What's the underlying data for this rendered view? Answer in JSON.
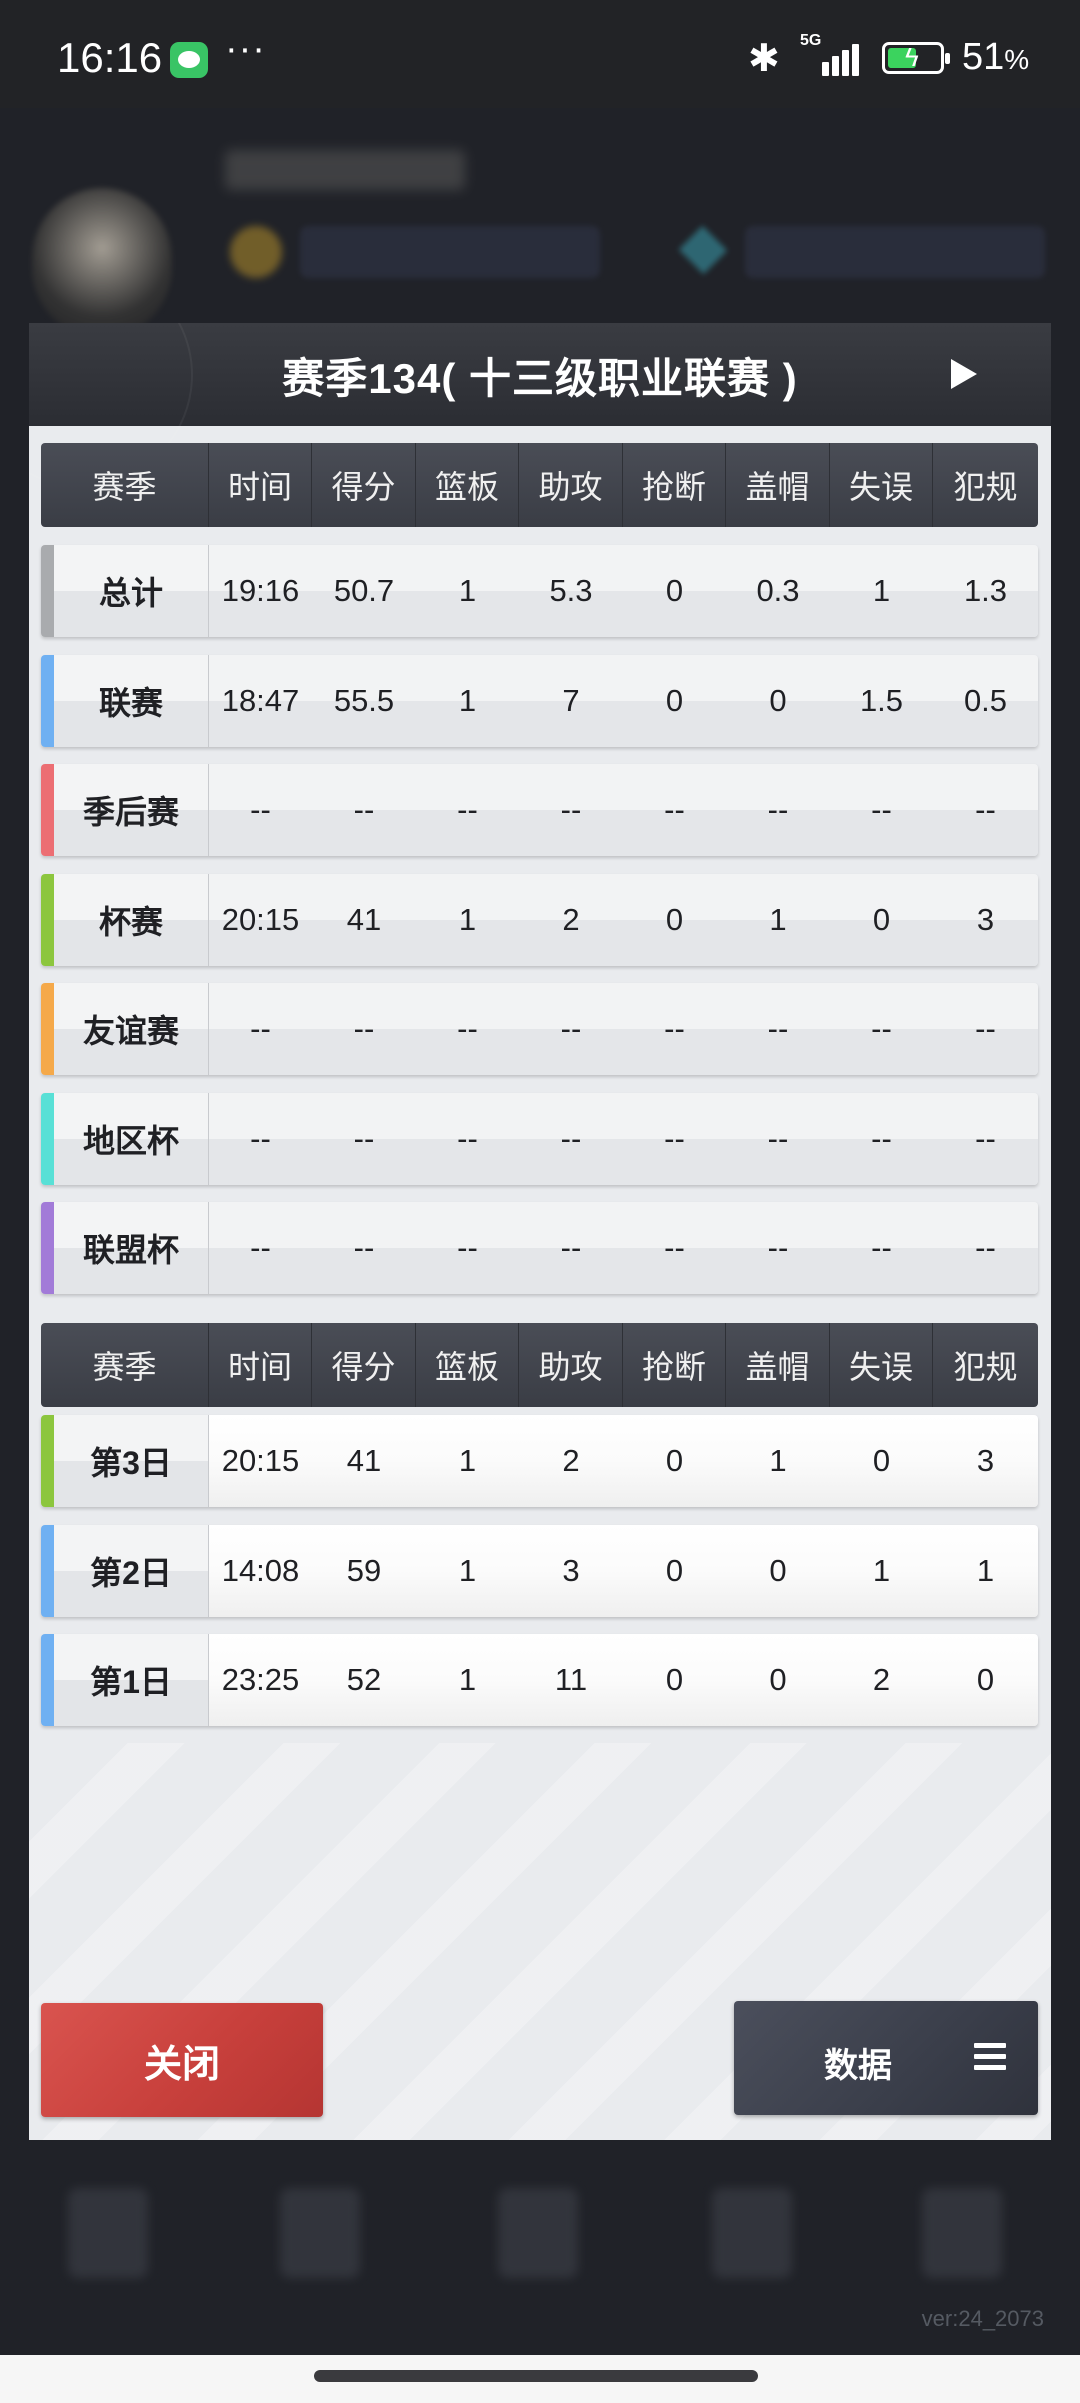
{
  "status_bar": {
    "time": "16:16",
    "battery": "51",
    "battery_unit": "%",
    "network": "5G",
    "more": "···"
  },
  "dialog": {
    "title": "赛季134( 十三级职业联赛 )",
    "columns": [
      "赛季",
      "时间",
      "得分",
      "篮板",
      "助攻",
      "抢断",
      "盖帽",
      "失误",
      "犯规"
    ],
    "season_rows": [
      {
        "label": "总计",
        "color": "#a9abae",
        "values": [
          "19:16",
          "50.7",
          "1",
          "5.3",
          "0",
          "0.3",
          "1",
          "1.3"
        ]
      },
      {
        "label": "联赛",
        "color": "#6fb0f2",
        "values": [
          "18:47",
          "55.5",
          "1",
          "7",
          "0",
          "0",
          "1.5",
          "0.5"
        ]
      },
      {
        "label": "季后赛",
        "color": "#ec6e73",
        "values": [
          "--",
          "--",
          "--",
          "--",
          "--",
          "--",
          "--",
          "--"
        ]
      },
      {
        "label": "杯赛",
        "color": "#8cc63e",
        "values": [
          "20:15",
          "41",
          "1",
          "2",
          "0",
          "1",
          "0",
          "3"
        ]
      },
      {
        "label": "友谊赛",
        "color": "#f5a94a",
        "values": [
          "--",
          "--",
          "--",
          "--",
          "--",
          "--",
          "--",
          "--"
        ]
      },
      {
        "label": "地区杯",
        "color": "#58e0d6",
        "values": [
          "--",
          "--",
          "--",
          "--",
          "--",
          "--",
          "--",
          "--"
        ]
      },
      {
        "label": "联盟杯",
        "color": "#a27bd8",
        "values": [
          "--",
          "--",
          "--",
          "--",
          "--",
          "--",
          "--",
          "--"
        ]
      }
    ],
    "day_rows": [
      {
        "label": "第3日",
        "color": "#8cc63e",
        "values": [
          "20:15",
          "41",
          "1",
          "2",
          "0",
          "1",
          "0",
          "3"
        ]
      },
      {
        "label": "第2日",
        "color": "#6fb0f2",
        "values": [
          "14:08",
          "59",
          "1",
          "3",
          "0",
          "0",
          "1",
          "1"
        ]
      },
      {
        "label": "第1日",
        "color": "#6fb0f2",
        "values": [
          "23:25",
          "52",
          "1",
          "11",
          "0",
          "0",
          "2",
          "0"
        ]
      }
    ],
    "close_label": "关闭",
    "data_label": "数据"
  },
  "version": "ver:24_2073"
}
